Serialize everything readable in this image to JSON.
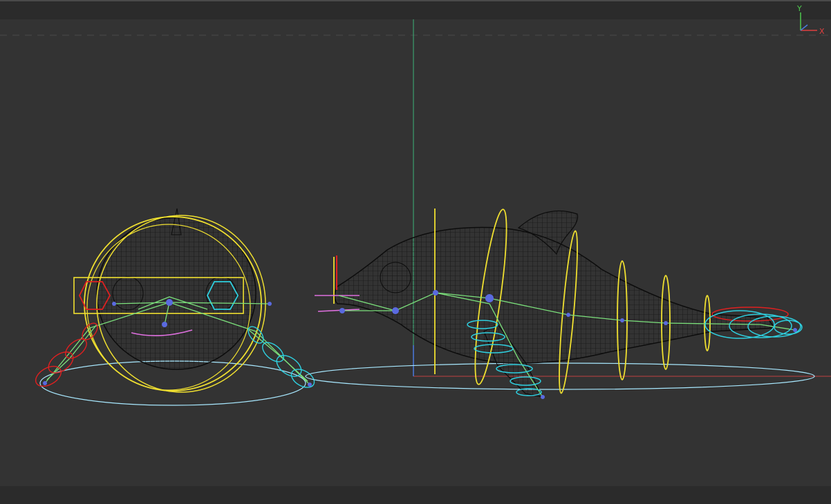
{
  "gizmo": {
    "y_label": "Y",
    "x_label": "X",
    "y_color": "#4ec94e",
    "x_color": "#e04040",
    "z_color": "#4a7be0"
  },
  "colors": {
    "background": "#333333",
    "bar": "#2b2b2b",
    "mesh": "#111111",
    "bone": "#7be07b",
    "control_yellow": "#f0e030",
    "control_cyan": "#2ed0e0",
    "control_red": "#e02020",
    "control_pink": "#e070e0",
    "ground_circle": "#a8e8ff",
    "grid_x_axis": "#c04040",
    "grid_y_axis": "#3cb47a"
  },
  "scene": {
    "front_view": "dolphin-rig-front",
    "side_view": "dolphin-rig-side"
  }
}
